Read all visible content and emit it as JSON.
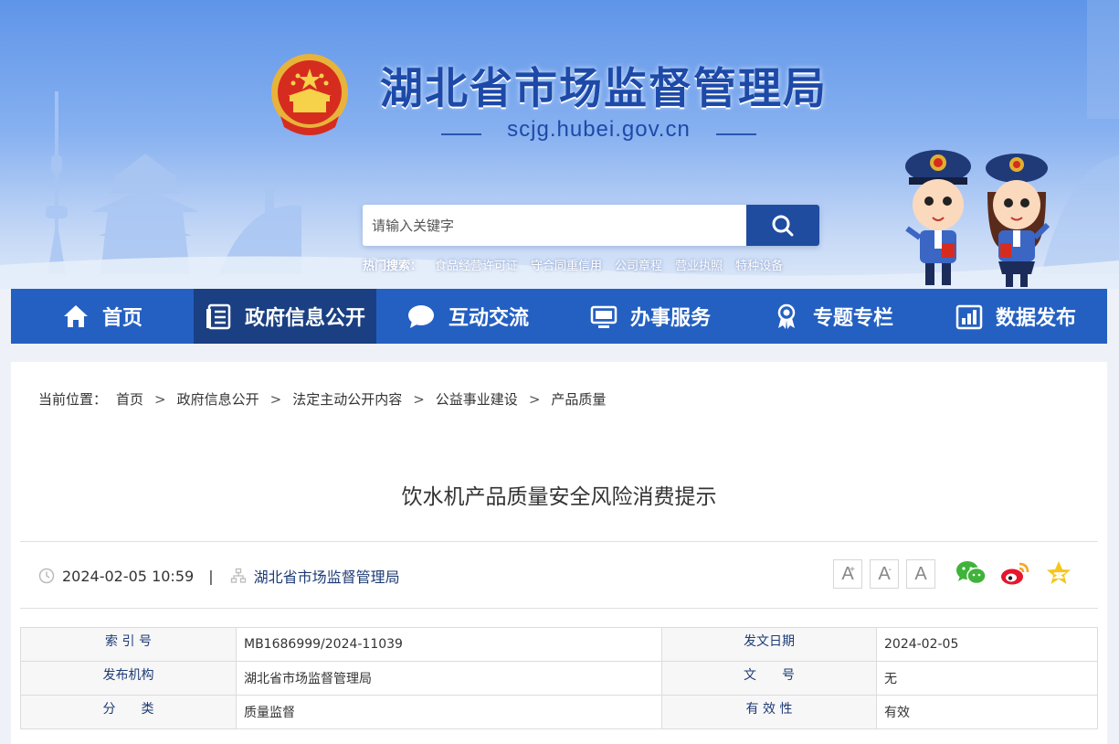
{
  "header": {
    "site_title": "湖北省市场监督管理局",
    "site_domain": "scjg.hubei.gov.cn"
  },
  "search": {
    "placeholder": "请输入关键字",
    "hot_label": "热门搜索：",
    "hot_items": [
      "食品经营许可证",
      "守合同重信用",
      "公司章程",
      "营业执照",
      "特种设备"
    ]
  },
  "nav": {
    "items": [
      {
        "label": "首页",
        "icon": "home-icon"
      },
      {
        "label": "政府信息公开",
        "icon": "document-list-icon",
        "active": true
      },
      {
        "label": "互动交流",
        "icon": "chat-bubble-icon"
      },
      {
        "label": "办事服务",
        "icon": "monitor-icon"
      },
      {
        "label": "专题专栏",
        "icon": "ribbon-award-icon"
      },
      {
        "label": "数据发布",
        "icon": "bar-chart-icon"
      }
    ]
  },
  "breadcrumb": {
    "label": "当前位置：",
    "items": [
      "首页",
      "政府信息公开",
      "法定主动公开内容",
      "公益事业建设",
      "产品质量"
    ],
    "separator": ">"
  },
  "article": {
    "title": "饮水机产品质量安全风险消费提示",
    "datetime": "2024-02-05 10:59",
    "divider": "|",
    "publisher": "湖北省市场监督管理局",
    "font_buttons": [
      "A",
      "A",
      "A"
    ],
    "font_button_marks": [
      "+",
      "-",
      ""
    ],
    "share_icons": [
      "wechat-icon",
      "weibo-icon",
      "favorite-star-icon"
    ]
  },
  "info_table": {
    "rows": [
      {
        "label1": "索 引 号",
        "value1": "MB1686999/2024-11039",
        "label2": "发文日期",
        "value2": "2024-02-05"
      },
      {
        "label1": "发布机构",
        "value1": "湖北省市场监督管理局",
        "label2": "文　　号",
        "value2": "无"
      },
      {
        "label1": "分　　类",
        "value1": "质量监督",
        "label2": "有 效 性",
        "value2": "有效"
      }
    ]
  },
  "colors": {
    "nav_bg": "#2460c1",
    "nav_active_bg": "#1a3f82",
    "search_button": "#1f4c9f",
    "title_blue": "#1d4aa8"
  }
}
